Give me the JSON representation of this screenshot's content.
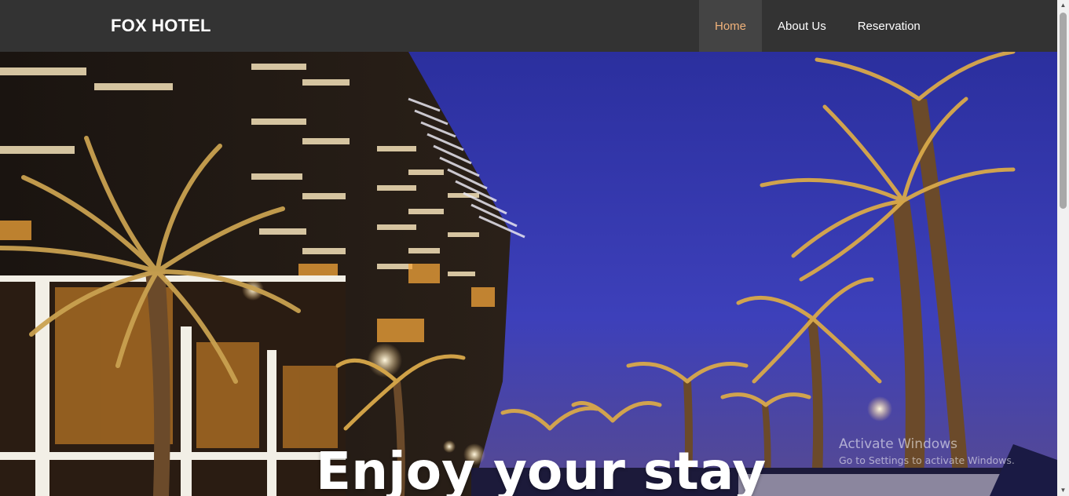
{
  "navbar": {
    "brand": "FOX HOTEL",
    "items": [
      {
        "label": "Home",
        "active": true
      },
      {
        "label": "About Us",
        "active": false
      },
      {
        "label": "Reservation",
        "active": false
      }
    ],
    "active_color": "#f0b27a",
    "background": "#333333"
  },
  "hero": {
    "title": "Enjoy your stay"
  },
  "watermark": {
    "title": "Activate Windows",
    "subtitle": "Go to Settings to activate Windows."
  },
  "scrollbar": {
    "up_icon": "triangle-up",
    "down_icon": "triangle-down"
  }
}
